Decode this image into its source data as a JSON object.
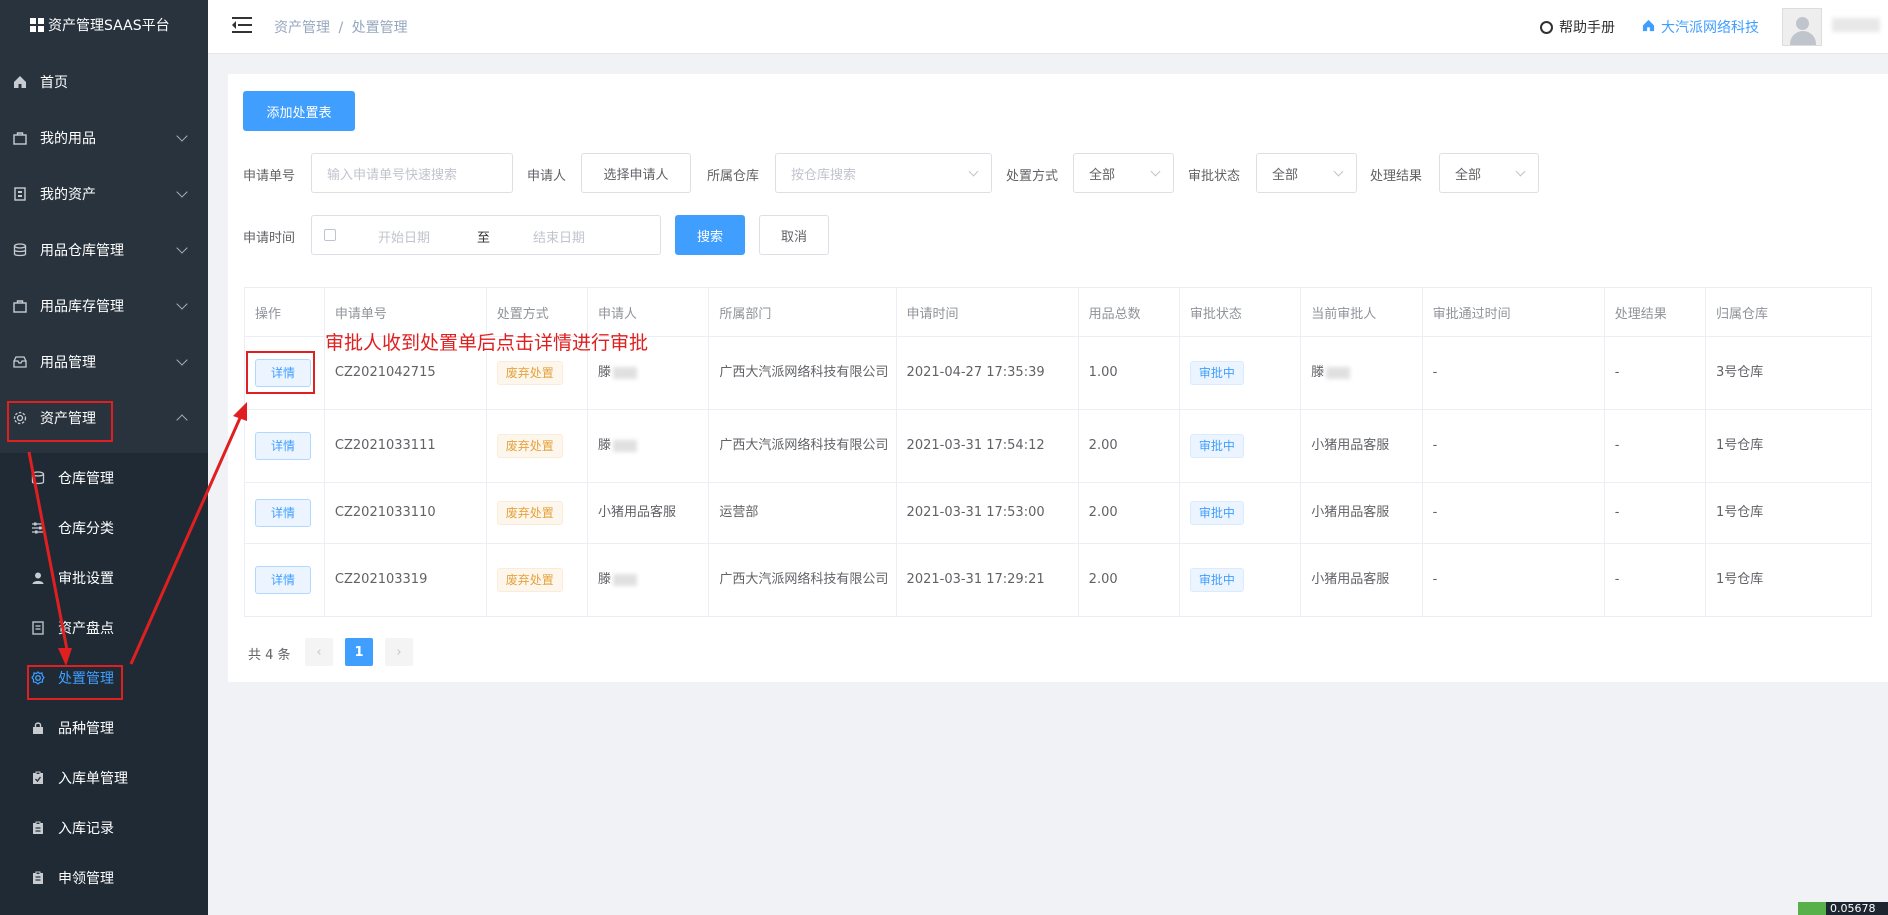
{
  "app_title": "资产管理SAAS平台",
  "sidebar": {
    "items": [
      {
        "label": "首页"
      },
      {
        "label": "我的用品"
      },
      {
        "label": "我的资产"
      },
      {
        "label": "用品仓库管理"
      },
      {
        "label": "用品库存管理"
      },
      {
        "label": "用品管理"
      },
      {
        "label": "资产管理"
      }
    ],
    "sub_items": [
      {
        "label": "仓库管理"
      },
      {
        "label": "仓库分类"
      },
      {
        "label": "审批设置"
      },
      {
        "label": "资产盘点"
      },
      {
        "label": "处置管理"
      },
      {
        "label": "品种管理"
      },
      {
        "label": "入库单管理"
      },
      {
        "label": "入库记录"
      },
      {
        "label": "申领管理"
      }
    ]
  },
  "header": {
    "breadcrumb_parent": "资产管理",
    "breadcrumb_sep": "/",
    "breadcrumb_current": "处置管理",
    "help_label": "帮助手册",
    "company_label": "大汽派网络科技"
  },
  "toolbar": {
    "add_label": "添加处置表"
  },
  "filters": {
    "apply_no_label": "申请单号",
    "apply_no_placeholder": "输入申请单号快速搜索",
    "applicant_label": "申请人",
    "applicant_button": "选择申请人",
    "warehouse_label": "所属仓库",
    "warehouse_placeholder": "按仓库搜索",
    "method_label": "处置方式",
    "method_value": "全部",
    "approval_label": "审批状态",
    "approval_value": "全部",
    "result_label": "处理结果",
    "result_value": "全部",
    "time_label": "申请时间",
    "start_placeholder": "开始日期",
    "range_sep": "至",
    "end_placeholder": "结束日期",
    "search_label": "搜索",
    "cancel_label": "取消"
  },
  "table": {
    "headers": [
      "操作",
      "申请单号",
      "处置方式",
      "申请人",
      "所属部门",
      "申请时间",
      "用品总数",
      "审批状态",
      "当前审批人",
      "审批通过时间",
      "处理结果",
      "归属仓库"
    ],
    "detail_label": "详情",
    "rows": [
      {
        "no": "CZ2021042715",
        "method": "废弃处置",
        "applicant": "滕",
        "dept": "广西大汽派网络科技有限公司",
        "time": "2021-04-27 17:35:39",
        "total": "1.00",
        "status": "审批中",
        "approver": "滕",
        "pass_time": "-",
        "result": "-",
        "warehouse": "3号仓库"
      },
      {
        "no": "CZ2021033111",
        "method": "废弃处置",
        "applicant": "滕",
        "dept": "广西大汽派网络科技有限公司",
        "time": "2021-03-31 17:54:12",
        "total": "2.00",
        "status": "审批中",
        "approver": "小猪用品客服",
        "pass_time": "-",
        "result": "-",
        "warehouse": "1号仓库"
      },
      {
        "no": "CZ2021033110",
        "method": "废弃处置",
        "applicant": "小猪用品客服",
        "dept": "运营部",
        "time": "2021-03-31 17:53:00",
        "total": "2.00",
        "status": "审批中",
        "approver": "小猪用品客服",
        "pass_time": "-",
        "result": "-",
        "warehouse": "1号仓库"
      },
      {
        "no": "CZ202103319",
        "method": "废弃处置",
        "applicant": "滕",
        "dept": "广西大汽派网络科技有限公司",
        "time": "2021-03-31 17:29:21",
        "total": "2.00",
        "status": "审批中",
        "approver": "小猪用品客服",
        "pass_time": "-",
        "result": "-",
        "warehouse": "1号仓库"
      }
    ]
  },
  "pagination": {
    "total_text": "共 4 条",
    "current_page": "1",
    "prev": "‹",
    "next": "›"
  },
  "annotation": {
    "note": "审批人收到处置单后点击详情进行审批",
    "color": "#e02020"
  },
  "corner_badge": "0.05678",
  "colors": {
    "sidebar_bg": "#28333e",
    "primary": "#409eff",
    "warning": "#e6a23c"
  }
}
